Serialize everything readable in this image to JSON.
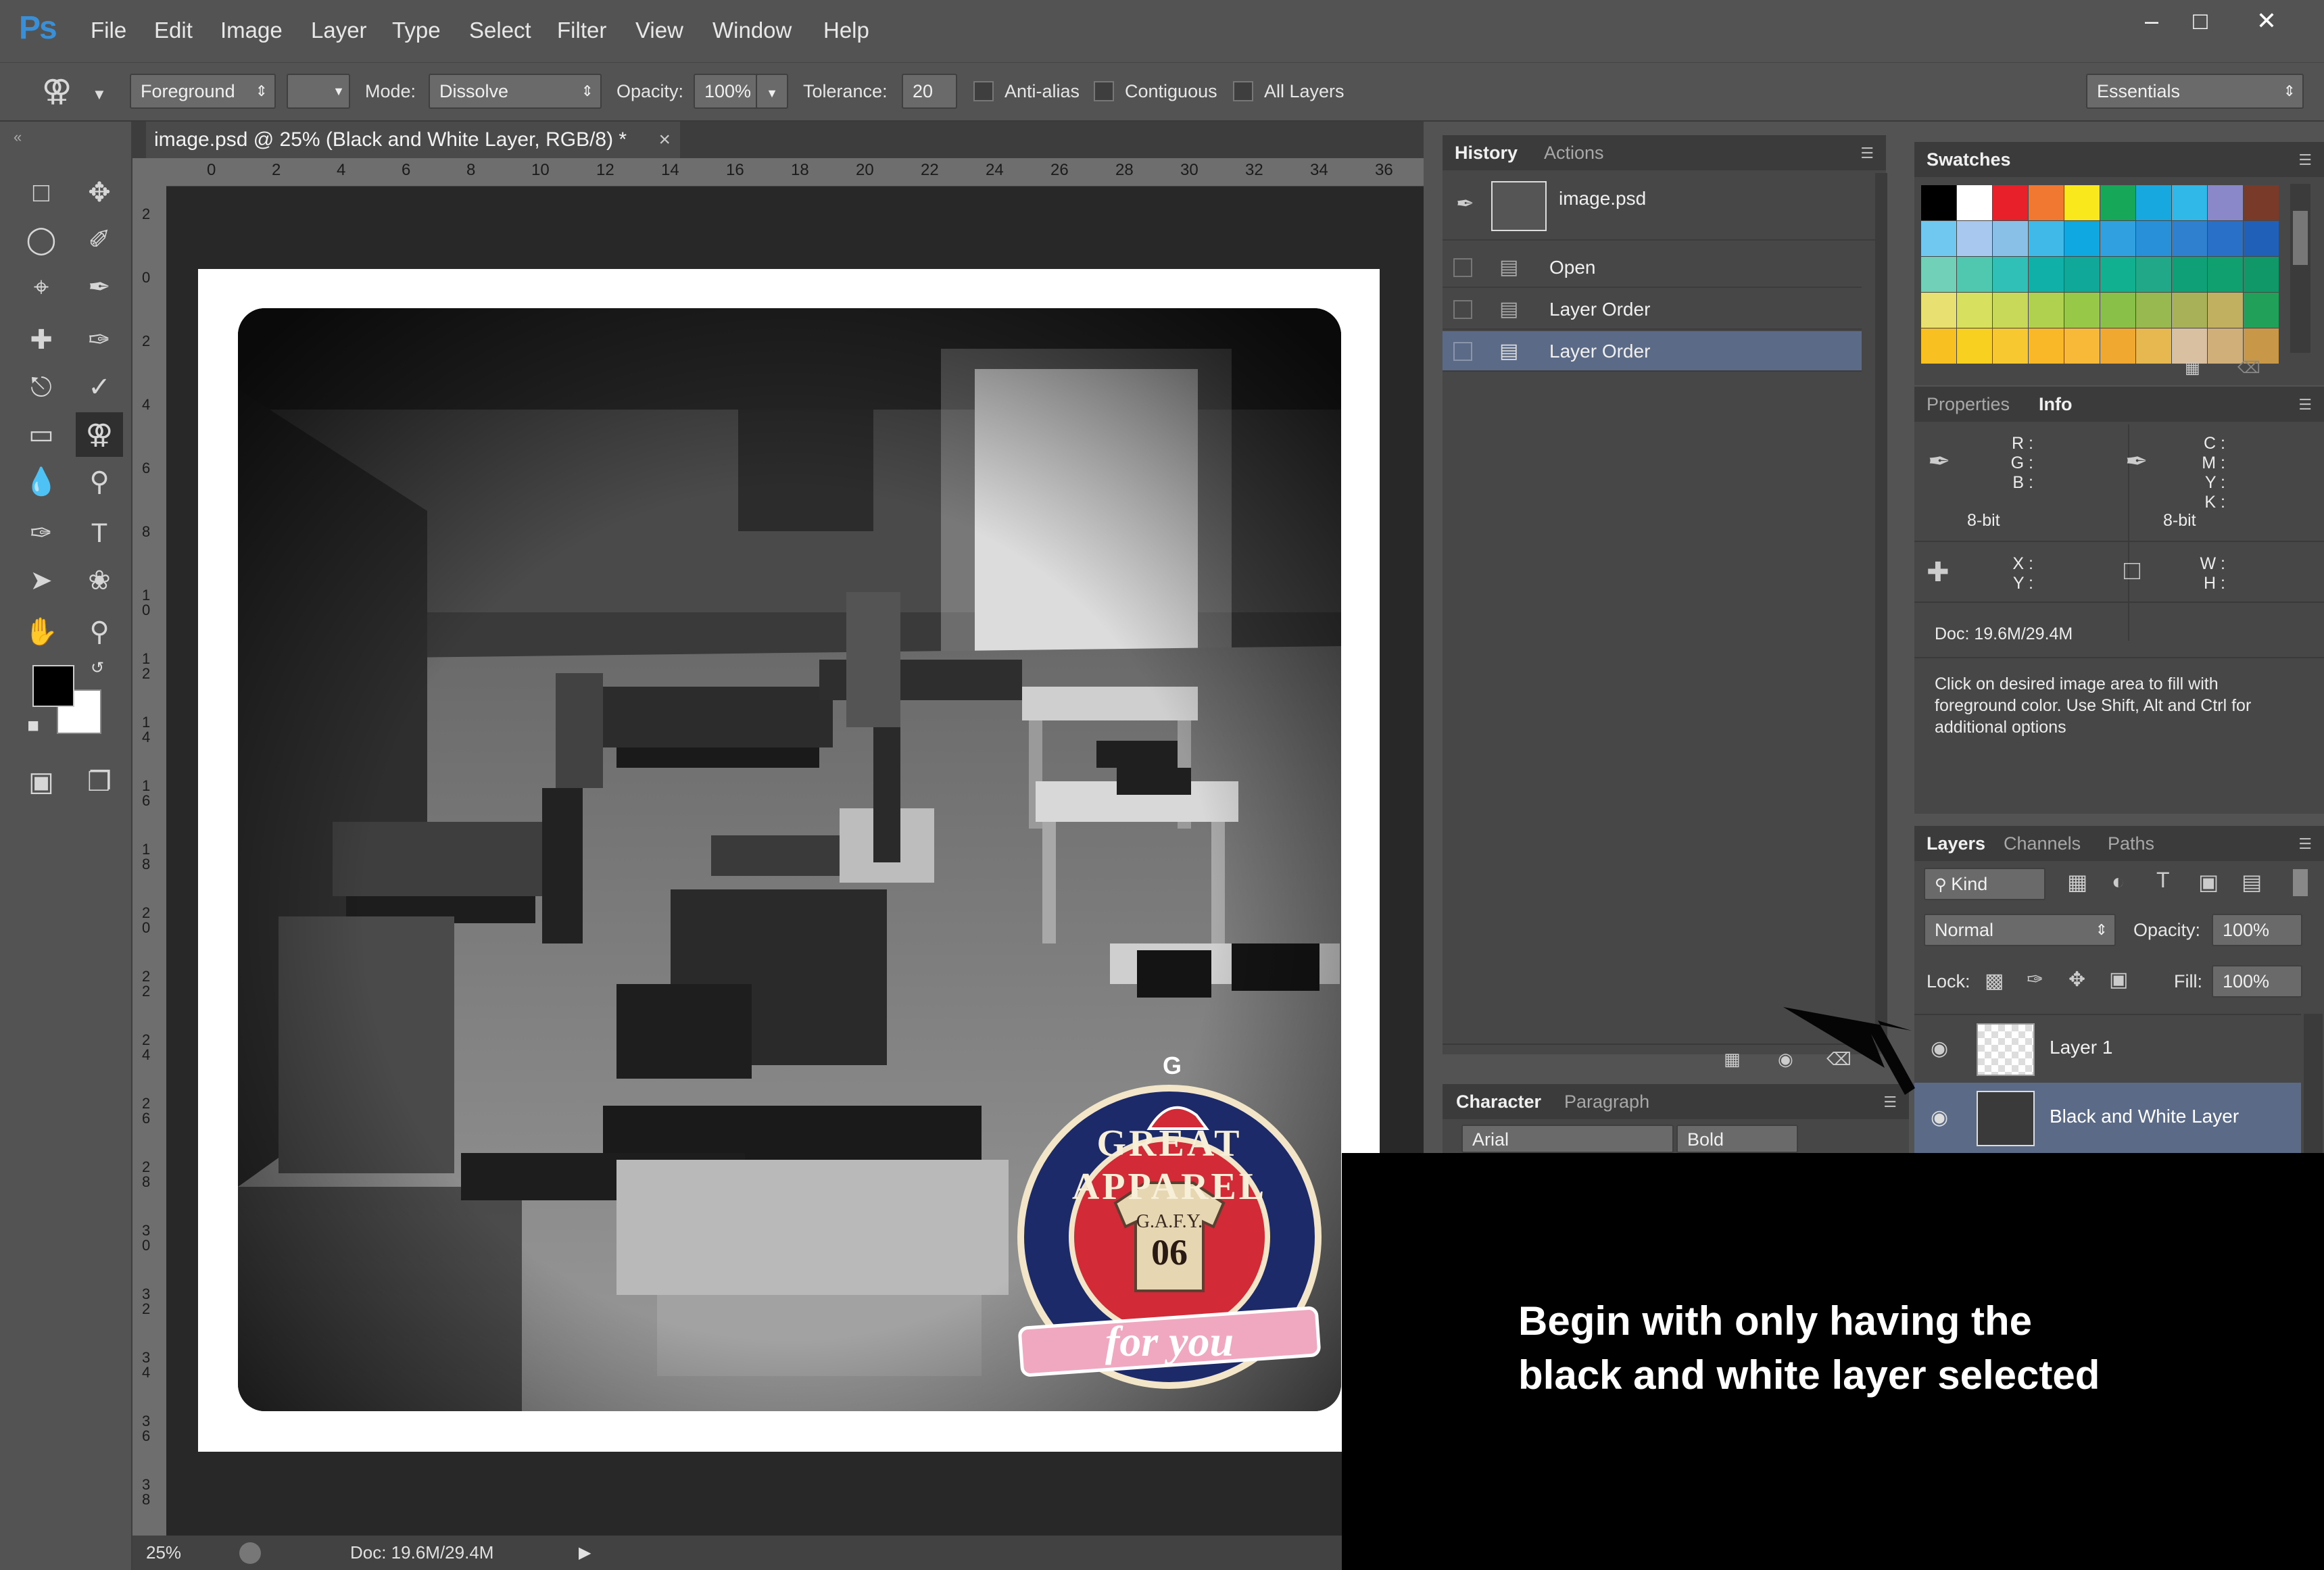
{
  "app": {
    "logo": "Ps"
  },
  "menu": [
    "File",
    "Edit",
    "Image",
    "Layer",
    "Type",
    "Select",
    "Filter",
    "View",
    "Window",
    "Help"
  ],
  "window_controls": [
    "–",
    "□",
    "✕"
  ],
  "options": {
    "fill_source": "Foreground",
    "mode_label": "Mode:",
    "mode_value": "Dissolve",
    "opacity_label": "Opacity:",
    "opacity_value": "100%",
    "tolerance_label": "Tolerance:",
    "tolerance_value": "20",
    "anti_alias": "Anti-alias",
    "contiguous": "Contiguous",
    "all_layers": "All Layers",
    "workspace": "Essentials"
  },
  "document": {
    "tab_title": "image.psd @ 25% (Black and White Layer, RGB/8) *",
    "tab_close": "×",
    "ruler_top": [
      "0",
      "2",
      "4",
      "6",
      "8",
      "10",
      "12",
      "14",
      "16",
      "18",
      "20",
      "22",
      "24",
      "26",
      "28",
      "30",
      "32",
      "34",
      "36"
    ],
    "ruler_left": [
      "2",
      "0",
      "2",
      "4",
      "6",
      "8",
      "1 0",
      "1 2",
      "1 4",
      "1 6",
      "1 8",
      "2 0",
      "2 2",
      "2 4",
      "2 6",
      "2 8",
      "3 0",
      "3 2",
      "3 4",
      "3 6",
      "3 8"
    ]
  },
  "status": {
    "zoom": "25%",
    "doc": "Doc: 19.6M/29.4M"
  },
  "history": {
    "tabs": [
      "History",
      "Actions"
    ],
    "snapshot": "image.psd",
    "steps": [
      "Open",
      "Layer Order",
      "Layer Order"
    ]
  },
  "swatches": {
    "tab": "Swatches",
    "colors": [
      [
        "#000000",
        "#ffffff",
        "#e8202a",
        "#f07830",
        "#f8e81c",
        "#16a858",
        "#18a8e0",
        "#30b8e8",
        "#8a88c8",
        "#7a3a2a"
      ],
      [
        "#70c8f0",
        "#a8c8f0",
        "#88c0e8",
        "#40b8e8",
        "#10a8e0",
        "#30a0e0",
        "#2890d8",
        "#3080d0",
        "#2870c8",
        "#2060b8"
      ],
      [
        "#70d0b8",
        "#50c8b0",
        "#30c0b8",
        "#10b0a8",
        "#10a898",
        "#10b090",
        "#20a888",
        "#10a078",
        "#10a070",
        "#109868"
      ],
      [
        "#e8e070",
        "#d8e060",
        "#c8d858",
        "#b0d050",
        "#98c848",
        "#88c048",
        "#98b850",
        "#a8b058",
        "#c0b060",
        "#20a058"
      ],
      [
        "#f8c020",
        "#f8d020",
        "#f8c830",
        "#f8b828",
        "#f8b838",
        "#f0a830",
        "#e8b850",
        "#d8c0a0",
        "#d0b078",
        "#c89848"
      ]
    ]
  },
  "properties": {
    "tabs": [
      "Properties",
      "Info"
    ],
    "rgb": [
      "R :",
      "G :",
      "B :"
    ],
    "cmyk": [
      "C :",
      "M :",
      "Y :",
      "K :"
    ],
    "bit_left": "8-bit",
    "bit_right": "8-bit",
    "xy": [
      "X :",
      "Y :"
    ],
    "wh": [
      "W :",
      "H :"
    ],
    "doc": "Doc: 19.6M/29.4M",
    "hint": "Click on desired image area to fill with foreground color.  Use Shift, Alt and Ctrl for additional options"
  },
  "character": {
    "tabs": [
      "Character",
      "Paragraph"
    ],
    "font": "Arial",
    "style": "Bold"
  },
  "layers": {
    "tabs": [
      "Layers",
      "Channels",
      "Paths"
    ],
    "filter": "Kind",
    "blend": "Normal",
    "opacity_label": "Opacity:",
    "opacity_value": "100%",
    "lock_label": "Lock:",
    "fill_label": "Fill:",
    "fill_value": "100%",
    "items": [
      "Layer 1",
      "Black and White Layer"
    ]
  },
  "logo_badge": {
    "top": "GREAT APPAREL",
    "shirt": "G.A.F.Y.",
    "number": "06",
    "banner": "for you",
    "cap": "G"
  },
  "overlay": {
    "line1": "Begin with only having the",
    "line2": "black and white layer selected"
  }
}
